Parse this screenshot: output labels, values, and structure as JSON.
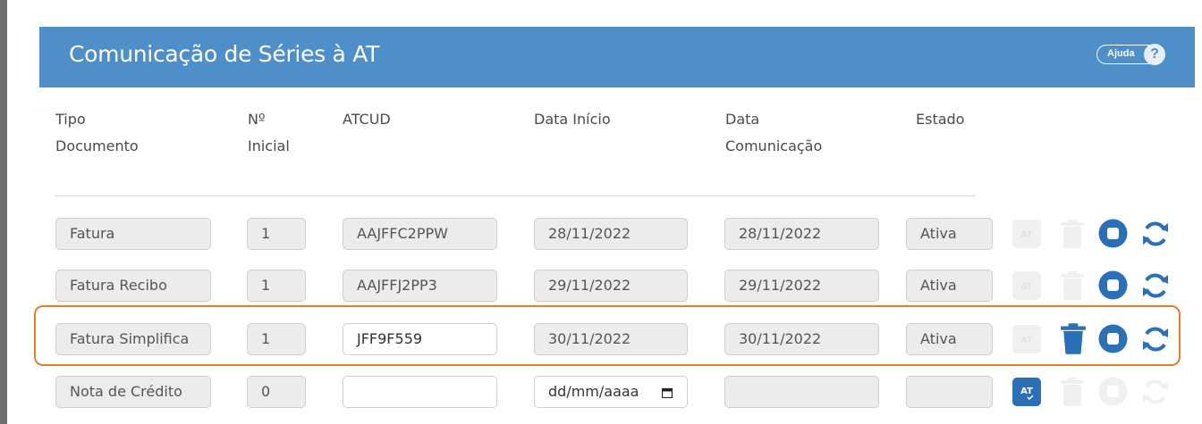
{
  "header": {
    "title": "Comunicação de Séries à AT",
    "help_label": "Ajuda",
    "help_icon": "?"
  },
  "columns": [
    [
      "Tipo",
      "Documento"
    ],
    [
      "Nº",
      "Inicial"
    ],
    [
      "ATCUD"
    ],
    [
      "Data Início"
    ],
    [
      "Data",
      "Comunicação"
    ],
    [
      "Estado"
    ]
  ],
  "rows": [
    {
      "tipo": "Fatura",
      "inicial": "1",
      "atcud": "AAJFFC2PPW",
      "data_inicio": "28/11/2022",
      "data_com": "28/11/2022",
      "estado": "Ativa"
    },
    {
      "tipo": "Fatura Recibo",
      "inicial": "1",
      "atcud": "AAJFFJ2PP3",
      "data_inicio": "29/11/2022",
      "data_com": "29/11/2022",
      "estado": "Ativa"
    },
    {
      "tipo": "Fatura Simplifica",
      "inicial": "1",
      "atcud": "JFF9F559",
      "data_inicio": "30/11/2022",
      "data_com": "30/11/2022",
      "estado": "Ativa"
    },
    {
      "tipo": "Nota de Crédito",
      "inicial": "0",
      "atcud": "",
      "data_inicio_placeholder": "dd/mm/aaaa",
      "data_com": "",
      "estado": ""
    }
  ],
  "icons": {
    "at": "AT",
    "primary": "#2b70b5",
    "disabled": "#dcdcdc",
    "highlight": "#e27d36"
  }
}
